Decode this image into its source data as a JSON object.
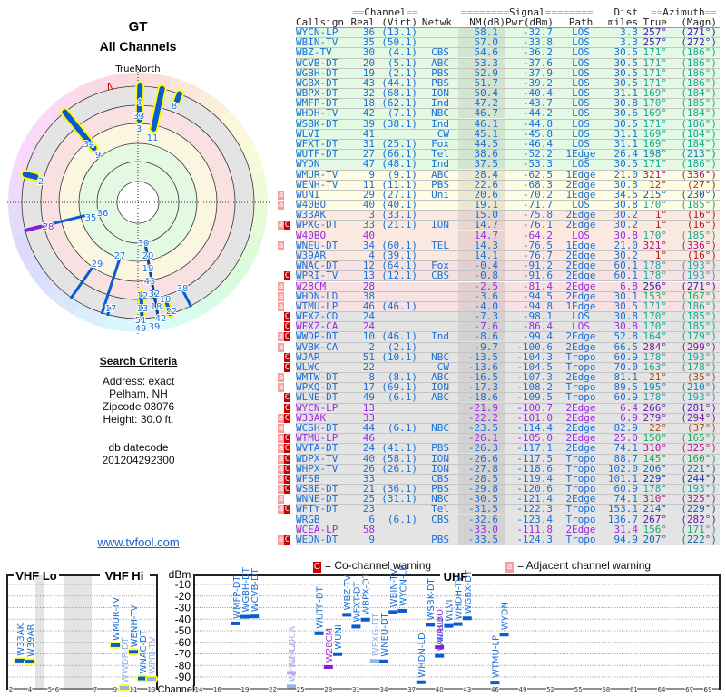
{
  "polar": {
    "title": "GT",
    "subtitle": "All Channels",
    "true_north": "TrueNorth",
    "mag_north": "N",
    "labels": [
      "4",
      "33",
      "3",
      "11",
      "8",
      "34",
      "9",
      "2",
      "35",
      "36",
      "28",
      "30",
      "20",
      "19",
      "43",
      "32",
      "18",
      "42",
      "39",
      "12",
      "13",
      "51",
      "49",
      "10",
      "22",
      "29",
      "27",
      "17",
      "38"
    ]
  },
  "criteria": {
    "heading": "Search Criteria",
    "address": "Address: exact",
    "city": "Pelham, NH",
    "zipcode": "Zipcode 03076",
    "height": "Height: 30.0 ft.",
    "db_label": "db datecode",
    "db_value": "201204292300",
    "link": "www.tvfool.com"
  },
  "table": {
    "group_channel": "Channel",
    "group_signal": "Signal",
    "group_dist": "Dist",
    "group_azimuth": "Azimuth",
    "headers": {
      "callsign": "Callsign",
      "real": "Real",
      "virt": "(Virt)",
      "netwk": "Netwk",
      "nm": "NM(dB)",
      "pwr": "Pwr(dBm)",
      "path": "Path",
      "dist": "miles",
      "az": "True",
      "mag": "(Magn)"
    },
    "rows": [
      {
        "w": "",
        "cs": "WYCN-LP",
        "ch": "36",
        "vc": "(13.1)",
        "net": "",
        "nm": "58.1",
        "pwr": "-32.7",
        "path": "LOS",
        "dist": "3.3",
        "az": "257°",
        "mag": "(271°)",
        "band": "green"
      },
      {
        "w": "",
        "cs": "WBIN-TV",
        "ch": "35",
        "vc": "(50.1)",
        "net": "",
        "nm": "57.0",
        "pwr": "-33.8",
        "path": "LOS",
        "dist": "3.3",
        "az": "257°",
        "mag": "(272°)",
        "band": "green"
      },
      {
        "w": "",
        "cs": "WBZ-TV",
        "ch": "30",
        "vc": "(4.1)",
        "net": "CBS",
        "nm": "54.6",
        "pwr": "-36.2",
        "path": "LOS",
        "dist": "30.5",
        "az": "171°",
        "mag": "(186°)",
        "band": "green"
      },
      {
        "w": "",
        "cs": "WCVB-DT",
        "ch": "20",
        "vc": "(5.1)",
        "net": "ABC",
        "nm": "53.3",
        "pwr": "-37.6",
        "path": "LOS",
        "dist": "30.5",
        "az": "171°",
        "mag": "(186°)",
        "band": "green"
      },
      {
        "w": "",
        "cs": "WGBH-DT",
        "ch": "19",
        "vc": "(2.1)",
        "net": "PBS",
        "nm": "52.9",
        "pwr": "-37.9",
        "path": "LOS",
        "dist": "30.5",
        "az": "171°",
        "mag": "(186°)",
        "band": "green"
      },
      {
        "w": "",
        "cs": "WGBX-DT",
        "ch": "43",
        "vc": "(44.1)",
        "net": "PBS",
        "nm": "51.7",
        "pwr": "-39.2",
        "path": "LOS",
        "dist": "30.5",
        "az": "171°",
        "mag": "(186°)",
        "band": "green"
      },
      {
        "w": "",
        "cs": "WBPX-DT",
        "ch": "32",
        "vc": "(68.1)",
        "net": "ION",
        "nm": "50.4",
        "pwr": "-40.4",
        "path": "LOS",
        "dist": "31.1",
        "az": "169°",
        "mag": "(184°)",
        "band": "green"
      },
      {
        "w": "",
        "cs": "WMFP-DT",
        "ch": "18",
        "vc": "(62.1)",
        "net": "Ind",
        "nm": "47.2",
        "pwr": "-43.7",
        "path": "LOS",
        "dist": "30.8",
        "az": "170°",
        "mag": "(185°)",
        "band": "green"
      },
      {
        "w": "",
        "cs": "WHDH-TV",
        "ch": "42",
        "vc": "(7.1)",
        "net": "NBC",
        "nm": "46.7",
        "pwr": "-44.2",
        "path": "LOS",
        "dist": "30.6",
        "az": "169°",
        "mag": "(184°)",
        "band": "green"
      },
      {
        "w": "",
        "cs": "WSBK-DT",
        "ch": "39",
        "vc": "(38.1)",
        "net": "Ind",
        "nm": "46.1",
        "pwr": "-44.8",
        "path": "LOS",
        "dist": "30.5",
        "az": "171°",
        "mag": "(186°)",
        "band": "green"
      },
      {
        "w": "",
        "cs": "WLVI",
        "ch": "41",
        "vc": "",
        "net": "CW",
        "nm": "45.1",
        "pwr": "-45.8",
        "path": "LOS",
        "dist": "31.1",
        "az": "169°",
        "mag": "(184°)",
        "band": "green"
      },
      {
        "w": "",
        "cs": "WFXT-DT",
        "ch": "31",
        "vc": "(25.1)",
        "net": "Fox",
        "nm": "44.5",
        "pwr": "-46.4",
        "path": "LOS",
        "dist": "31.1",
        "az": "169°",
        "mag": "(184°)",
        "band": "green"
      },
      {
        "w": "",
        "cs": "WUTF-DT",
        "ch": "27",
        "vc": "(66.1)",
        "net": "Tel",
        "nm": "38.6",
        "pwr": "-52.2",
        "path": "1Edge",
        "dist": "26.4",
        "az": "198°",
        "mag": "(213°)",
        "band": "green"
      },
      {
        "w": "",
        "cs": "WYDN",
        "ch": "47",
        "vc": "(48.1)",
        "net": "Ind",
        "nm": "37.5",
        "pwr": "-53.3",
        "path": "LOS",
        "dist": "30.5",
        "az": "171°",
        "mag": "(186°)",
        "band": "green"
      },
      {
        "w": "",
        "cs": "WMUR-TV",
        "ch": "9",
        "vc": "(9.1)",
        "net": "ABC",
        "nm": "28.4",
        "pwr": "-62.5",
        "path": "1Edge",
        "dist": "21.0",
        "az": "321°",
        "mag": "(336°)",
        "band": "yellow"
      },
      {
        "w": "",
        "cs": "WENH-TV",
        "ch": "11",
        "vc": "(11.1)",
        "net": "PBS",
        "nm": "22.6",
        "pwr": "-68.3",
        "path": "2Edge",
        "dist": "30.3",
        "az": "12°",
        "mag": "(27°)",
        "band": "yellow"
      },
      {
        "w": "a",
        "cs": "WUNI",
        "ch": "29",
        "vc": "(27.1)",
        "net": "Uni",
        "nm": "20.6",
        "pwr": "-70.2",
        "path": "1Edge",
        "dist": "34.5",
        "az": "215°",
        "mag": "(230°)",
        "band": "yellow"
      },
      {
        "w": "a",
        "cs": "W40BO",
        "ch": "40",
        "vc": "(40.1)",
        "net": "",
        "nm": "19.1",
        "pwr": "-71.7",
        "path": "LOS",
        "dist": "30.8",
        "az": "170°",
        "mag": "(185°)",
        "band": "yellow"
      },
      {
        "w": "",
        "cs": "W33AK",
        "ch": "3",
        "vc": "(33.1)",
        "net": "",
        "nm": "15.0",
        "pwr": "-75.8",
        "path": "2Edge",
        "dist": "30.2",
        "az": "1°",
        "mag": "(16°)",
        "band": "orange"
      },
      {
        "w": "aC",
        "cs": "WPXG-DT",
        "ch": "33",
        "vc": "(21.1)",
        "net": "ION",
        "nm": "14.7",
        "pwr": "-76.1",
        "path": "2Edge",
        "dist": "30.2",
        "az": "1°",
        "mag": "(16°)",
        "band": "orange"
      },
      {
        "w": "",
        "cs": "W40BO",
        "ch": "40",
        "vc": "",
        "net": "",
        "nm": "14.7",
        "pwr": "-64.2",
        "path": "LOS",
        "dist": "30.8",
        "az": "170°",
        "mag": "(185°)",
        "band": "orange",
        "purple": true
      },
      {
        "w": "a",
        "cs": "WNEU-DT",
        "ch": "34",
        "vc": "(60.1)",
        "net": "TEL",
        "nm": "14.3",
        "pwr": "-76.5",
        "path": "1Edge",
        "dist": "21.0",
        "az": "321°",
        "mag": "(336°)",
        "band": "orange"
      },
      {
        "w": "",
        "cs": "W39AR",
        "ch": "4",
        "vc": "(39.1)",
        "net": "",
        "nm": "14.1",
        "pwr": "-76.7",
        "path": "2Edge",
        "dist": "30.2",
        "az": "1°",
        "mag": "(16°)",
        "band": "orange"
      },
      {
        "w": "",
        "cs": "WNAC-DT",
        "ch": "12",
        "vc": "(64.1)",
        "net": "Fox",
        "nm": "-0.4",
        "pwr": "-91.2",
        "path": "2Edge",
        "dist": "60.1",
        "az": "178°",
        "mag": "(193°)",
        "band": "red"
      },
      {
        "w": "C",
        "cs": "WPRI-TV",
        "ch": "13",
        "vc": "(12.1)",
        "net": "CBS",
        "nm": "-0.8",
        "pwr": "-91.6",
        "path": "2Edge",
        "dist": "60.1",
        "az": "178°",
        "mag": "(193°)",
        "band": "red"
      },
      {
        "w": "a",
        "cs": "W28CM",
        "ch": "28",
        "vc": "",
        "net": "",
        "nm": "-2.5",
        "pwr": "-81.4",
        "path": "2Edge",
        "dist": "6.8",
        "az": "256°",
        "mag": "(271°)",
        "band": "red",
        "purple": true
      },
      {
        "w": "a",
        "cs": "WHDN-LD",
        "ch": "38",
        "vc": "",
        "net": "",
        "nm": "-3.6",
        "pwr": "-94.5",
        "path": "2Edge",
        "dist": "30.1",
        "az": "153°",
        "mag": "(167°)",
        "band": "red"
      },
      {
        "w": "a",
        "cs": "WTMU-LP",
        "ch": "46",
        "vc": "(46.1)",
        "net": "",
        "nm": "-4.0",
        "pwr": "-94.8",
        "path": "1Edge",
        "dist": "30.5",
        "az": "171°",
        "mag": "(186°)",
        "band": "red"
      },
      {
        "w": "C",
        "cs": "WFXZ-CD",
        "ch": "24",
        "vc": "",
        "net": "",
        "nm": "-7.3",
        "pwr": "-98.1",
        "path": "LOS",
        "dist": "30.8",
        "az": "170°",
        "mag": "(185°)",
        "band": "gray"
      },
      {
        "w": "C",
        "cs": "WFXZ-CA",
        "ch": "24",
        "vc": "",
        "net": "",
        "nm": "-7.6",
        "pwr": "-86.4",
        "path": "LOS",
        "dist": "30.8",
        "az": "170°",
        "mag": "(185°)",
        "band": "gray",
        "purple": true
      },
      {
        "w": "aC",
        "cs": "WWDP-DT",
        "ch": "10",
        "vc": "(46.1)",
        "net": "Ind",
        "nm": "-8.6",
        "pwr": "-99.4",
        "path": "2Edge",
        "dist": "52.8",
        "az": "164°",
        "mag": "(179°)",
        "band": "gray"
      },
      {
        "w": "a",
        "cs": "WVBK-CA",
        "ch": "2",
        "vc": "(2.1)",
        "net": "",
        "nm": "-9.7",
        "pwr": "-100.6",
        "path": "2Edge",
        "dist": "66.5",
        "az": "284°",
        "mag": "(299°)",
        "band": "gray"
      },
      {
        "w": "C",
        "cs": "WJAR",
        "ch": "51",
        "vc": "(10.1)",
        "net": "NBC",
        "nm": "-13.5",
        "pwr": "-104.3",
        "path": "Tropo",
        "dist": "60.9",
        "az": "178°",
        "mag": "(193°)",
        "band": "gray"
      },
      {
        "w": "C",
        "cs": "WLWC",
        "ch": "22",
        "vc": "",
        "net": "CW",
        "nm": "-13.6",
        "pwr": "-104.5",
        "path": "Tropo",
        "dist": "70.0",
        "az": "163°",
        "mag": "(178°)",
        "band": "gray"
      },
      {
        "w": "a",
        "cs": "WMTW-DT",
        "ch": "8",
        "vc": "(8.1)",
        "net": "ABC",
        "nm": "-16.5",
        "pwr": "-107.3",
        "path": "2Edge",
        "dist": "81.1",
        "az": "21°",
        "mag": "(35°)",
        "band": "gray"
      },
      {
        "w": "a",
        "cs": "WPXQ-DT",
        "ch": "17",
        "vc": "(69.1)",
        "net": "ION",
        "nm": "-17.3",
        "pwr": "-108.2",
        "path": "Tropo",
        "dist": "89.5",
        "az": "195°",
        "mag": "(210°)",
        "band": "gray"
      },
      {
        "w": "C",
        "cs": "WLNE-DT",
        "ch": "49",
        "vc": "(6.1)",
        "net": "ABC",
        "nm": "-18.6",
        "pwr": "-109.5",
        "path": "Tropo",
        "dist": "60.9",
        "az": "178°",
        "mag": "(193°)",
        "band": "gray"
      },
      {
        "w": "C",
        "cs": "WYCN-LP",
        "ch": "13",
        "vc": "",
        "net": "",
        "nm": "-21.9",
        "pwr": "-100.7",
        "path": "2Edge",
        "dist": "6.4",
        "az": "266°",
        "mag": "(281°)",
        "band": "gray",
        "purple": true
      },
      {
        "w": "aC",
        "cs": "W33AK",
        "ch": "33",
        "vc": "",
        "net": "",
        "nm": "-22.2",
        "pwr": "-101.0",
        "path": "2Edge",
        "dist": "6.9",
        "az": "279°",
        "mag": "(294°)",
        "band": "gray",
        "purple": true
      },
      {
        "w": "a",
        "cs": "WCSH-DT",
        "ch": "44",
        "vc": "(6.1)",
        "net": "NBC",
        "nm": "-23.5",
        "pwr": "-114.4",
        "path": "2Edge",
        "dist": "82.9",
        "az": "22°",
        "mag": "(37°)",
        "band": "gray"
      },
      {
        "w": "aC",
        "cs": "WTMU-LP",
        "ch": "46",
        "vc": "",
        "net": "",
        "nm": "-26.1",
        "pwr": "-105.0",
        "path": "2Edge",
        "dist": "25.0",
        "az": "150°",
        "mag": "(165°)",
        "band": "gray",
        "purple": true
      },
      {
        "w": "aC",
        "cs": "WVTA-DT",
        "ch": "24",
        "vc": "(41.1)",
        "net": "PBS",
        "nm": "-26.3",
        "pwr": "-117.1",
        "path": "2Edge",
        "dist": "74.1",
        "az": "310°",
        "mag": "(325°)",
        "band": "gray"
      },
      {
        "w": "aC",
        "cs": "WDPX-TV",
        "ch": "40",
        "vc": "(58.1)",
        "net": "ION",
        "nm": "-26.6",
        "pwr": "-117.5",
        "path": "Tropo",
        "dist": "88.7",
        "az": "145°",
        "mag": "(160°)",
        "band": "gray"
      },
      {
        "w": "aC",
        "cs": "WHPX-TV",
        "ch": "26",
        "vc": "(26.1)",
        "net": "ION",
        "nm": "-27.8",
        "pwr": "-118.6",
        "path": "Tropo",
        "dist": "102.0",
        "az": "206°",
        "mag": "(221°)",
        "band": "gray"
      },
      {
        "w": "aC",
        "cs": "WFSB",
        "ch": "33",
        "vc": "",
        "net": "CBS",
        "nm": "-28.5",
        "pwr": "-119.4",
        "path": "Tropo",
        "dist": "101.1",
        "az": "229°",
        "mag": "(244°)",
        "band": "gray"
      },
      {
        "w": "aC",
        "cs": "WSBE-DT",
        "ch": "21",
        "vc": "(36.1)",
        "net": "PBS",
        "nm": "-29.8",
        "pwr": "-120.6",
        "path": "Tropo",
        "dist": "60.9",
        "az": "178°",
        "mag": "(193°)",
        "band": "gray"
      },
      {
        "w": "a",
        "cs": "WNNE-DT",
        "ch": "25",
        "vc": "(31.1)",
        "net": "NBC",
        "nm": "-30.5",
        "pwr": "-121.4",
        "path": "2Edge",
        "dist": "74.1",
        "az": "310°",
        "mag": "(325°)",
        "band": "gray"
      },
      {
        "w": "aC",
        "cs": "WFTY-DT",
        "ch": "23",
        "vc": "",
        "net": "Tel",
        "nm": "-31.5",
        "pwr": "-122.3",
        "path": "Tropo",
        "dist": "153.1",
        "az": "214°",
        "mag": "(229°)",
        "band": "gray"
      },
      {
        "w": "",
        "cs": "WRGB",
        "ch": "6",
        "vc": "(6.1)",
        "net": "CBS",
        "nm": "-32.6",
        "pwr": "-123.4",
        "path": "Tropo",
        "dist": "136.7",
        "az": "267°",
        "mag": "(282°)",
        "band": "gray"
      },
      {
        "w": "",
        "cs": "WCEA-LP",
        "ch": "58",
        "vc": "",
        "net": "",
        "nm": "-33.0",
        "pwr": "-111.8",
        "path": "2Edge",
        "dist": "31.4",
        "az": "156°",
        "mag": "(171°)",
        "band": "gray",
        "purple": true
      },
      {
        "w": "aC",
        "cs": "WEDN-DT",
        "ch": "9",
        "vc": "",
        "net": "PBS",
        "nm": "-33.5",
        "pwr": "-124.3",
        "path": "Tropo",
        "dist": "94.9",
        "az": "207°",
        "mag": "(222°)",
        "band": "gray"
      }
    ]
  },
  "legend": {
    "co_icon": "C",
    "co_label": "= Co-channel warning",
    "adj_icon": "a",
    "adj_label": "= Adjacent channel warning"
  },
  "spectrum": {
    "vhf_lo": "VHF Lo",
    "vhf_hi": "VHF Hi",
    "uhf": "UHF",
    "unit": "dBm",
    "channel_label": "Channel",
    "dbm_ticks": [
      "-10",
      "-20",
      "-30",
      "-40",
      "-50",
      "-60",
      "-70",
      "-80",
      "-90"
    ],
    "vhf_ticks": [
      "2",
      "4",
      "5",
      "6",
      "7",
      "9",
      "11",
      "13"
    ],
    "uhf_ticks": [
      "14",
      "16",
      "19",
      "22",
      "25",
      "28",
      "31",
      "34",
      "37",
      "40",
      "43",
      "46",
      "49",
      "52",
      "55",
      "58",
      "61",
      "64",
      "67",
      "69"
    ]
  },
  "colors": {
    "text": "#1a6fd6",
    "lp": "#9a2be0",
    "co_channel": "#cc0000",
    "adjacent": "#f4a0a0",
    "vhf_highlight": "#ffff00"
  }
}
